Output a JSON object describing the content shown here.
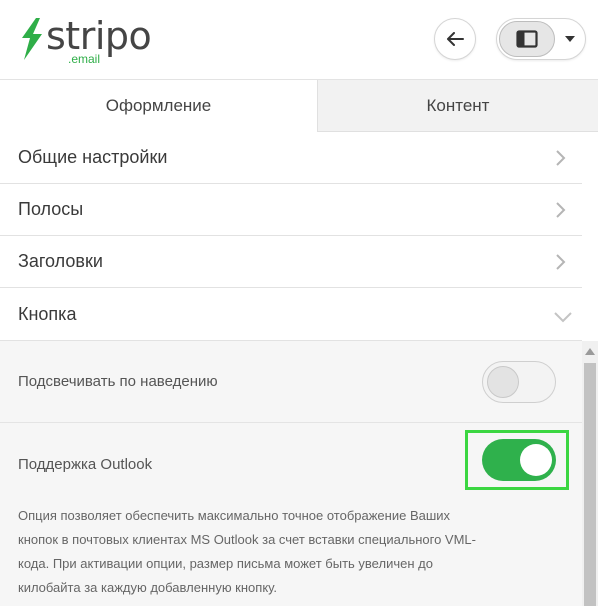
{
  "header": {
    "logo": {
      "word": "stripo",
      "sub": ".email"
    },
    "back_icon": "arrow-left-icon",
    "view_icon": "panel-layout-icon",
    "view_menu_icon": "caret-down-icon"
  },
  "tabs": [
    {
      "label": "Оформление",
      "active": true
    },
    {
      "label": "Контент",
      "active": false
    }
  ],
  "sections": [
    {
      "label": "Общие настройки",
      "expanded": false
    },
    {
      "label": "Полосы",
      "expanded": false
    },
    {
      "label": "Заголовки",
      "expanded": false
    },
    {
      "label": "Кнопка",
      "expanded": true
    }
  ],
  "button_settings": {
    "hover_highlight": {
      "label": "Подсвечивать по наведению",
      "enabled": false
    },
    "outlook_support": {
      "label": "Поддержка Outlook",
      "enabled": true,
      "description_lines": [
        "Опция позволяет обеспечить максимально точное отображение Ваших",
        "кнопок в почтовых клиентах MS Outlook за счет вставки специального VML-",
        "кода. При активации опции, размер письма может быть увеличен до",
        "килобайта за каждую добавленную кнопку."
      ]
    }
  },
  "colors": {
    "brand_green": "#2fae48",
    "toggle_on": "#2fb14c",
    "highlight_border": "#3bd641"
  }
}
